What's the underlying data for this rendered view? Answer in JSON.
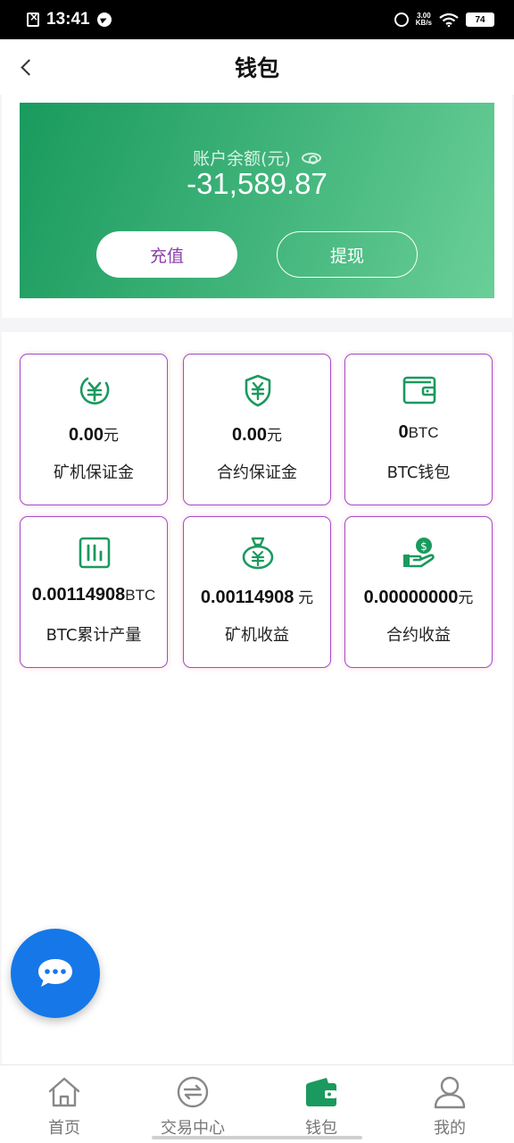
{
  "status_bar": {
    "time": "13:41",
    "net_speed_value": "3.00",
    "net_speed_unit": "KB/s",
    "battery": "74",
    "icons": [
      "screenshot-icon",
      "telegram-icon",
      "alarm-icon",
      "wifi-icon",
      "battery-icon"
    ]
  },
  "header": {
    "title": "钱包",
    "back_icon": "chevron-left-icon"
  },
  "balance": {
    "label": "账户余额(元)",
    "amount": "-31,589.87",
    "recharge_label": "充值",
    "withdraw_label": "提现"
  },
  "stats": [
    {
      "icon": "yuan-circle-icon",
      "value": "0.00",
      "unit": "元",
      "label": "矿机保证金"
    },
    {
      "icon": "yuan-shield-icon",
      "value": "0.00",
      "unit": "元",
      "label": "合约保证金"
    },
    {
      "icon": "wallet-icon",
      "value": "0",
      "unit": "BTC",
      "label": "BTC钱包"
    },
    {
      "icon": "bar-chart-icon",
      "value": "0.00114908",
      "unit": "BTC",
      "label": "BTC累计产量"
    },
    {
      "icon": "money-bag-icon",
      "value": "0.00114908",
      "unit": " 元",
      "label": "矿机收益"
    },
    {
      "icon": "hand-coin-icon",
      "value": "0.00000000",
      "unit": "元",
      "label": "合约收益"
    }
  ],
  "bottom_nav": [
    {
      "label": "首页",
      "icon": "home-icon",
      "active": false
    },
    {
      "label": "交易中心",
      "icon": "exchange-icon",
      "active": false
    },
    {
      "label": "钱包",
      "icon": "wallet-icon",
      "active": true
    },
    {
      "label": "我的",
      "icon": "user-icon",
      "active": false
    }
  ],
  "colors": {
    "primary_green": "#1a9a5e",
    "card_border_purple": "#a34bc9",
    "recharge_text": "#8a3ea8",
    "chat_blue": "#1677e8"
  }
}
